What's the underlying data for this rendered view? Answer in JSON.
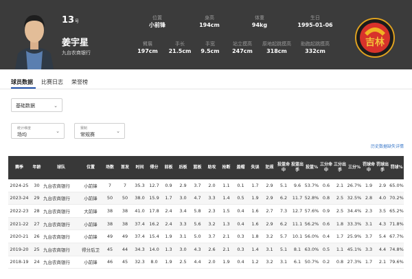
{
  "player": {
    "number": "13",
    "number_suffix": "号",
    "name": "姜宇星",
    "team": "九台农商银行"
  },
  "bio_row1": [
    {
      "label": "位置",
      "value": "小前锋"
    },
    {
      "label": "身高",
      "value": "194cm"
    },
    {
      "label": "体重",
      "value": "94kg"
    },
    {
      "label": "生日",
      "value": "1995-01-06"
    }
  ],
  "bio_row2": [
    {
      "label": "臂展",
      "value": "197cm"
    },
    {
      "label": "手长",
      "value": "21.5cm"
    },
    {
      "label": "手宽",
      "value": "9.5cm"
    },
    {
      "label": "站立摸高",
      "value": "247cm"
    },
    {
      "label": "原地起跳摸高",
      "value": "318cm"
    },
    {
      "label": "助跑起跳摸高",
      "value": "332cm"
    }
  ],
  "logo_text": "吉林",
  "colors": {
    "header_bg": "#3b3b3b",
    "accent": "#1f4fa8",
    "link": "#3a78c9",
    "table_header": "#383838"
  },
  "tabs": [
    "球员数据",
    "比赛日志",
    "荣誉榜"
  ],
  "selects": {
    "basic": "基础数据",
    "chevron_icon": "chevron-down-icon",
    "stat_dim": {
      "label": "统计维度",
      "value": "场均"
    },
    "season_type": {
      "label": "赛制",
      "value": "常规赛"
    }
  },
  "history_link": "历史数据缺失详情",
  "table": {
    "headers": [
      "赛季",
      "年龄",
      "球队",
      "位置",
      "场数",
      "首发",
      "时间",
      "得分",
      "前板",
      "后板",
      "篮板",
      "助攻",
      "抢断",
      "盖帽",
      "失误",
      "犯规",
      "投篮命中",
      "投篮出手",
      "投篮%",
      "三分命中",
      "三分出手",
      "三分%",
      "罚球命中",
      "罚球出手",
      "罚球%"
    ],
    "rows": [
      [
        "2024-25",
        "30",
        "九台农商银行",
        "小前锋",
        "7",
        "7",
        "35.3",
        "12.7",
        "0.9",
        "2.9",
        "3.7",
        "2.0",
        "1.1",
        "0.1",
        "1.7",
        "2.9",
        "5.1",
        "9.6",
        "53.7%",
        "0.6",
        "2.1",
        "26.7%",
        "1.9",
        "2.9",
        "65.0%"
      ],
      [
        "2023-24",
        "29",
        "九台农商银行",
        "小前锋",
        "50",
        "50",
        "38.0",
        "15.9",
        "1.7",
        "3.0",
        "4.7",
        "3.3",
        "1.4",
        "0.5",
        "1.9",
        "2.9",
        "6.2",
        "11.7",
        "52.8%",
        "0.8",
        "2.5",
        "32.5%",
        "2.8",
        "4.0",
        "70.2%"
      ],
      [
        "2022-23",
        "28",
        "九台农商银行",
        "大前锋",
        "38",
        "38",
        "41.0",
        "17.8",
        "2.4",
        "3.4",
        "5.8",
        "2.3",
        "1.5",
        "0.4",
        "1.6",
        "2.7",
        "7.3",
        "12.7",
        "57.6%",
        "0.9",
        "2.5",
        "34.4%",
        "2.3",
        "3.5",
        "65.2%"
      ],
      [
        "2021-22",
        "27",
        "九台农商银行",
        "小前锋",
        "38",
        "38",
        "37.4",
        "16.2",
        "2.4",
        "3.3",
        "5.6",
        "3.2",
        "1.3",
        "0.4",
        "1.6",
        "2.9",
        "6.2",
        "11.1",
        "56.2%",
        "0.6",
        "1.8",
        "33.3%",
        "3.1",
        "4.3",
        "71.8%"
      ],
      [
        "2020-21",
        "26",
        "九台农商银行",
        "小前锋",
        "49",
        "49",
        "37.4",
        "15.4",
        "1.9",
        "3.1",
        "5.0",
        "3.7",
        "2.1",
        "0.3",
        "1.8",
        "3.2",
        "5.7",
        "10.1",
        "56.0%",
        "0.4",
        "1.7",
        "25.9%",
        "3.7",
        "5.4",
        "67.7%"
      ],
      [
        "2019-20",
        "25",
        "九台农商银行",
        "得分后卫",
        "45",
        "44",
        "34.3",
        "14.0",
        "1.3",
        "3.0",
        "4.3",
        "2.6",
        "2.1",
        "0.3",
        "1.4",
        "3.1",
        "5.1",
        "8.1",
        "63.0%",
        "0.5",
        "1.1",
        "45.1%",
        "3.3",
        "4.4",
        "74.8%"
      ],
      [
        "2018-19",
        "24",
        "九台农商银行",
        "小前锋",
        "46",
        "45",
        "32.3",
        "8.0",
        "1.9",
        "2.5",
        "4.4",
        "2.0",
        "1.9",
        "0.4",
        "1.2",
        "3.2",
        "3.1",
        "6.1",
        "50.7%",
        "0.2",
        "0.8",
        "27.3%",
        "1.7",
        "2.1",
        "79.6%"
      ]
    ]
  }
}
